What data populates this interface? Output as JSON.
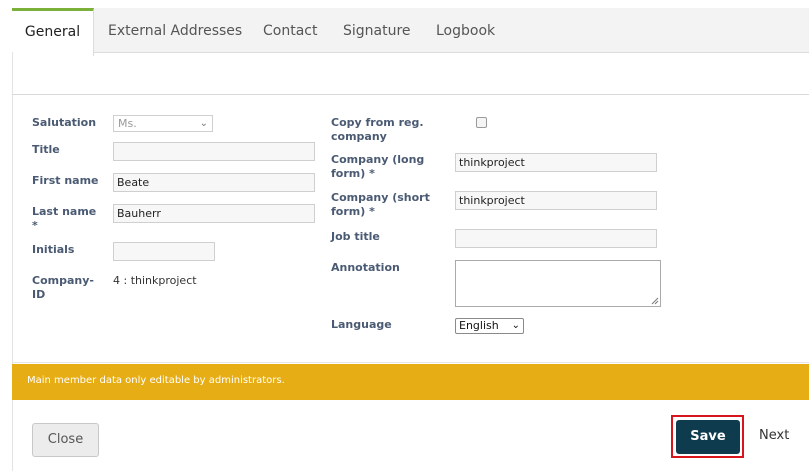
{
  "tabs": [
    {
      "label": "General",
      "active": true
    },
    {
      "label": "External Addresses",
      "active": false
    },
    {
      "label": "Contact",
      "active": false
    },
    {
      "label": "Signature",
      "active": false
    },
    {
      "label": "Logbook",
      "active": false
    }
  ],
  "form": {
    "salutation": {
      "label": "Salutation",
      "value": "Ms."
    },
    "title": {
      "label": "Title",
      "value": ""
    },
    "first_name": {
      "label": "First name",
      "value": "Beate"
    },
    "last_name": {
      "label": "Last name *",
      "value": "Bauherr"
    },
    "initials": {
      "label": "Initials",
      "value": ""
    },
    "company_id": {
      "label": "Company-ID",
      "value": "4 : thinkproject"
    },
    "copy_from_reg_company": {
      "label": "Copy from reg. company",
      "checked": false
    },
    "company_long": {
      "label": "Company (long form) *",
      "value": "thinkproject"
    },
    "company_short": {
      "label": "Company (short form) *",
      "value": "thinkproject"
    },
    "job_title": {
      "label": "Job title",
      "value": ""
    },
    "annotation": {
      "label": "Annotation",
      "value": ""
    },
    "language": {
      "label": "Language",
      "value": "English"
    }
  },
  "banner": {
    "text": "Main member data only editable by administrators.",
    "color": "#e6ad14"
  },
  "buttons": {
    "close": "Close",
    "save": "Save",
    "next": "Next"
  },
  "colors": {
    "accent_tab": "#7bb03a",
    "save_bg": "#0f3b4f",
    "highlight": "#d8141c"
  }
}
